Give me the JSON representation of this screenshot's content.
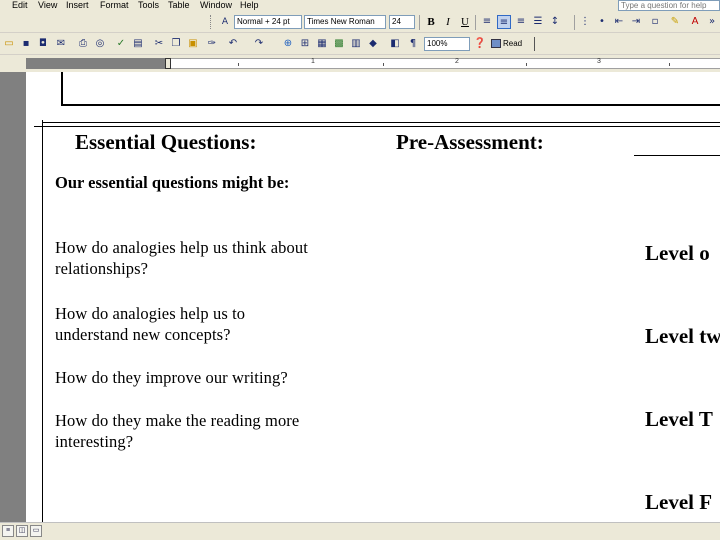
{
  "menu": {
    "items": [
      "Edit",
      "View",
      "Insert",
      "Format",
      "Tools",
      "Table",
      "Window",
      "Help"
    ],
    "help_placeholder": "Type a question for help"
  },
  "formatting": {
    "style": "Normal + 24 pt",
    "font": "Times New Roman",
    "size": "24"
  },
  "standard": {
    "zoom": "100%",
    "read_label": "Read"
  },
  "ruler": {
    "numbers": [
      "1",
      "2",
      "3"
    ]
  },
  "document": {
    "col1_heading": "Essential Questions:",
    "col2_heading": "Pre-Assessment:",
    "intro": "Our essential questions might be:",
    "questions": [
      "How do analogies help us think about relationships?",
      "How do analogies help us to understand new concepts?",
      "How do they improve our writing?",
      "How do they make the reading more interesting?"
    ],
    "levels": [
      "Level o",
      "Level tw",
      "Level T",
      "Level F"
    ]
  },
  "colors": {
    "chrome": "#ece9d8",
    "gutter": "#808080",
    "accent": "#316ac5"
  }
}
